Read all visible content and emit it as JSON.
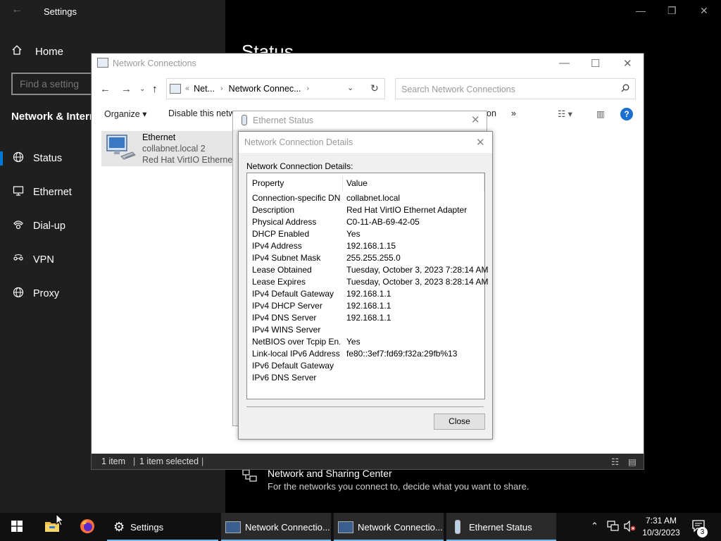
{
  "settings": {
    "title": "Settings",
    "home": "Home",
    "find_placeholder": "Find a setting",
    "section": "Network & Internet",
    "nav": [
      {
        "label": "Status",
        "icon": "globe-icon"
      },
      {
        "label": "Ethernet",
        "icon": "ethernet-icon"
      },
      {
        "label": "Dial-up",
        "icon": "dialup-icon"
      },
      {
        "label": "VPN",
        "icon": "vpn-icon"
      },
      {
        "label": "Proxy",
        "icon": "globe-icon"
      }
    ],
    "page_title": "Status",
    "sharing_center": {
      "title": "Network and Sharing Center",
      "desc": "For the networks you connect to, decide what you want to share."
    }
  },
  "netconn": {
    "title": "Network Connections",
    "breadcrumb": [
      "Net...",
      "Network Connec..."
    ],
    "search_placeholder": "Search Network Connections",
    "commands": {
      "organize": "Organize",
      "disable": "Disable this netwo",
      "partial": "on",
      "more": "»"
    },
    "item": {
      "name": "Ethernet",
      "network": "collabnet.local 2",
      "adapter": "Red Hat VirtIO Ethernet A"
    },
    "status": {
      "count": "1 item",
      "selected": "1 item selected"
    }
  },
  "ethernet_status": {
    "title": "Ethernet Status"
  },
  "details": {
    "title": "Network Connection Details",
    "label": "Network Connection Details:",
    "columns": [
      "Property",
      "Value"
    ],
    "rows": [
      {
        "property": "Connection-specific DN...",
        "value": "collabnet.local"
      },
      {
        "property": "Description",
        "value": "Red Hat VirtIO Ethernet Adapter"
      },
      {
        "property": "Physical Address",
        "value": "C0-11-AB-69-42-05"
      },
      {
        "property": "DHCP Enabled",
        "value": "Yes"
      },
      {
        "property": "IPv4 Address",
        "value": "192.168.1.15"
      },
      {
        "property": "IPv4 Subnet Mask",
        "value": "255.255.255.0"
      },
      {
        "property": "Lease Obtained",
        "value": "Tuesday, October 3, 2023 7:28:14 AM"
      },
      {
        "property": "Lease Expires",
        "value": "Tuesday, October 3, 2023 8:28:14 AM"
      },
      {
        "property": "IPv4 Default Gateway",
        "value": "192.168.1.1"
      },
      {
        "property": "IPv4 DHCP Server",
        "value": "192.168.1.1"
      },
      {
        "property": "IPv4 DNS Server",
        "value": "192.168.1.1"
      },
      {
        "property": "IPv4 WINS Server",
        "value": ""
      },
      {
        "property": "NetBIOS over Tcpip En...",
        "value": "Yes"
      },
      {
        "property": "Link-local IPv6 Address",
        "value": "fe80::3ef7:fd69:f32a:29fb%13"
      },
      {
        "property": "IPv6 Default Gateway",
        "value": ""
      },
      {
        "property": "IPv6 DNS Server",
        "value": ""
      }
    ],
    "close_label": "Close"
  },
  "taskbar": {
    "apps": [
      {
        "label": "Settings",
        "icon": "gear-icon"
      },
      {
        "label": "Network Connectio...",
        "icon": "network-connections-icon"
      },
      {
        "label": "Network Connectio...",
        "icon": "network-connections-icon"
      },
      {
        "label": "Ethernet Status",
        "icon": "ethernet-status-icon"
      }
    ],
    "time": "7:31 AM",
    "date": "10/3/2023",
    "notification_count": "3"
  }
}
